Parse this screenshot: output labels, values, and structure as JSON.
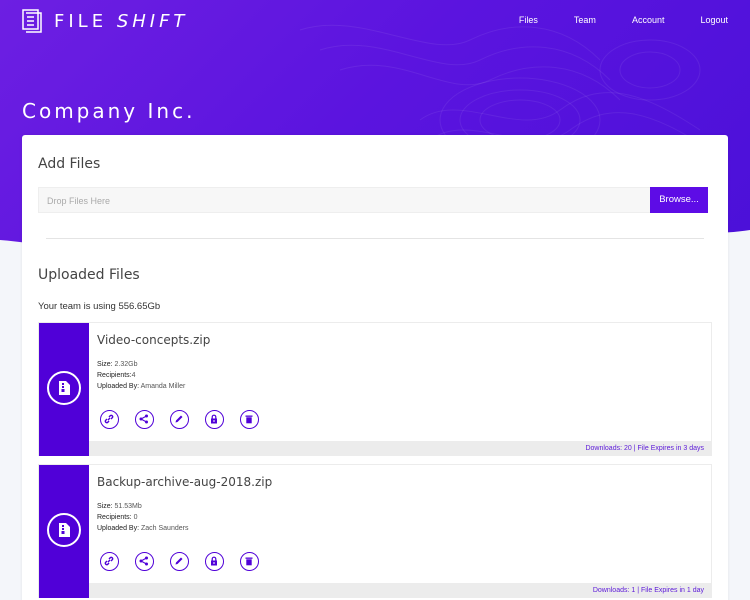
{
  "brand": {
    "part1": "FILE",
    "part2": "SHIFT",
    "icon": "file-stack-icon"
  },
  "nav": {
    "files": "Files",
    "team": "Team",
    "account": "Account",
    "logout": "Logout"
  },
  "company": "Company Inc.",
  "add_files": {
    "title": "Add Files",
    "placeholder": "Drop Files Here",
    "browse_label": "Browse..."
  },
  "uploaded": {
    "title": "Uploaded Files",
    "usage": "Your team is using 556.65Gb"
  },
  "files": [
    {
      "name": "Video-concepts.zip",
      "size_label": "Size:",
      "size": "2.32Gb",
      "recipients_label": "Recipients:",
      "recipients": "4",
      "uploaded_label": "Uploaded By:",
      "uploaded_by": "Amanda Miller",
      "footer": "Downloads: 20 | File Expires in 3 days"
    },
    {
      "name": "Backup-archive-aug-2018.zip",
      "size_label": "Size:",
      "size": "51.53Mb",
      "recipients_label": "Recipients:",
      "recipients": "0",
      "uploaded_label": "Uploaded By:",
      "uploaded_by": "Zach Saunders",
      "footer": "Downloads: 1 | File Expires in 1 day"
    }
  ],
  "action_icons": [
    "link-icon",
    "share-icon",
    "edit-icon",
    "lock-icon",
    "trash-icon"
  ],
  "colors": {
    "primary": "#5d0ce6",
    "accent": "#5000d8",
    "background": "#f4f6fa"
  }
}
